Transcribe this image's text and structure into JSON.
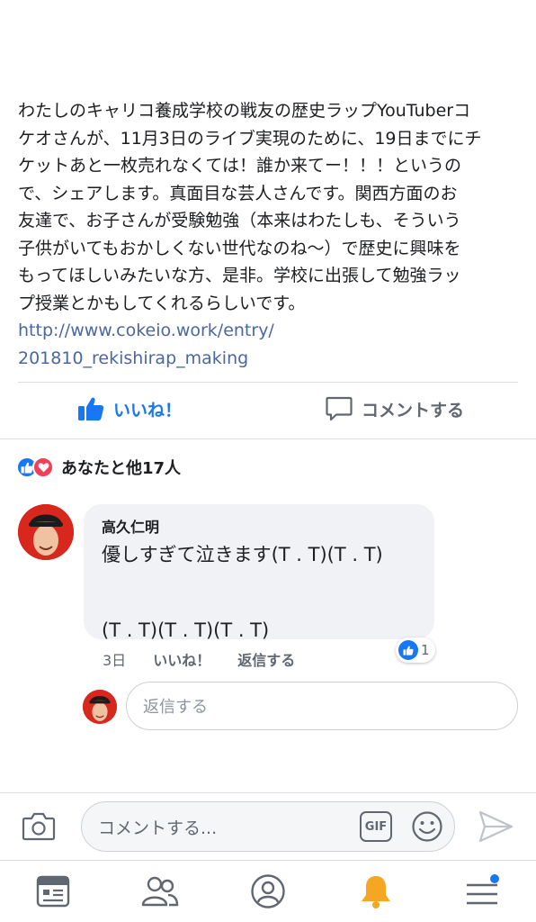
{
  "post": {
    "text_lines": [
      "わたしのキャリコ養成学校の戦友の歴史ラップYouTuberコ",
      "ケオさんが、11月3日のライブ実現のために、19日までにチ",
      "ケットあと一枚売れなくては！誰か来てー！！！というの",
      "で、シェアします。真面目な芸人さんです。関西方面のお",
      "友達で、お子さんが受験勉強（本来はわたしも、そういう",
      "子供がいてもおかしくない世代なのね〜）で歴史に興味を",
      "もってほしいみたいな方、是非。学校に出張して勉強ラッ",
      "プ授業とかもしてくれるらしいです。"
    ],
    "link_lines": [
      "http://www.cokeio.work/entry/",
      "201810_rekishirap_making"
    ]
  },
  "actions": {
    "like_label": "いいね！",
    "comment_label": "コメントする"
  },
  "reactions": {
    "summary": "あなたと他17人"
  },
  "comment": {
    "author": "高久仁明",
    "line1": "優しすぎて泣きます(T . T)(T . T)",
    "line2": "(T . T)(T . T)(T . T)",
    "time": "3日",
    "like_label": "いいね！",
    "reply_label": "返信する",
    "reaction_count": "1"
  },
  "reply": {
    "placeholder": "返信する"
  },
  "composer": {
    "placeholder": "コメントする...",
    "gif_label": "GIF"
  },
  "colors": {
    "accent": "#1877f2",
    "love": "#f33e58",
    "notification": "#f5a623"
  },
  "icons": [
    "like-thumb-icon",
    "comment-bubble-icon",
    "camera-icon",
    "gif-icon",
    "emoji-icon",
    "send-icon",
    "news-feed-icon",
    "friends-icon",
    "profile-icon",
    "bell-icon",
    "menu-icon"
  ]
}
